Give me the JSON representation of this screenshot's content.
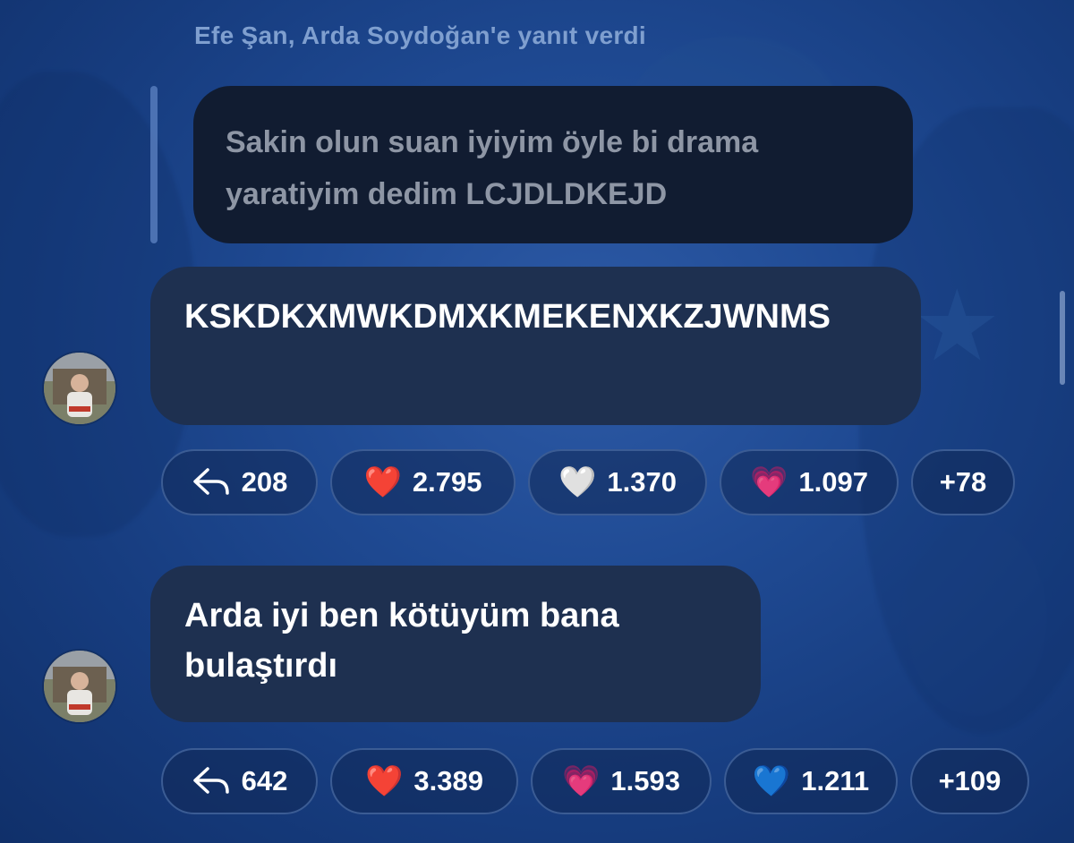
{
  "reply_header": "Efe Şan, Arda Soydoğan'e yanıt verdi",
  "quoted_message": {
    "text": "Sakin olun suan iyiyim öyle bi drama yaratiyim dedim LCJDLDKEJD"
  },
  "messages": [
    {
      "text": "KSKDKXMWKDMXKMEKENXKZJWNMS",
      "reactions": {
        "reply_count": "208",
        "items": [
          {
            "emoji": "❤️",
            "count": "2.795"
          },
          {
            "emoji": "🤍",
            "count": "1.370"
          },
          {
            "emoji": "💗",
            "count": "1.097"
          }
        ],
        "more": "+78"
      }
    },
    {
      "text": "Arda iyi ben kötüyüm bana bulaştırdı",
      "reactions": {
        "reply_count": "642",
        "items": [
          {
            "emoji": "❤️",
            "count": "3.389"
          },
          {
            "emoji": "💗",
            "count": "1.593"
          },
          {
            "emoji": "💙",
            "count": "1.211"
          }
        ],
        "more": "+109"
      }
    }
  ],
  "icons": {
    "reply": "reply-arrow-icon",
    "avatar": "user-avatar"
  },
  "colors": {
    "bubble": "#1e3050",
    "quoted_bubble": "#111c31",
    "background": "#1f4a93"
  }
}
